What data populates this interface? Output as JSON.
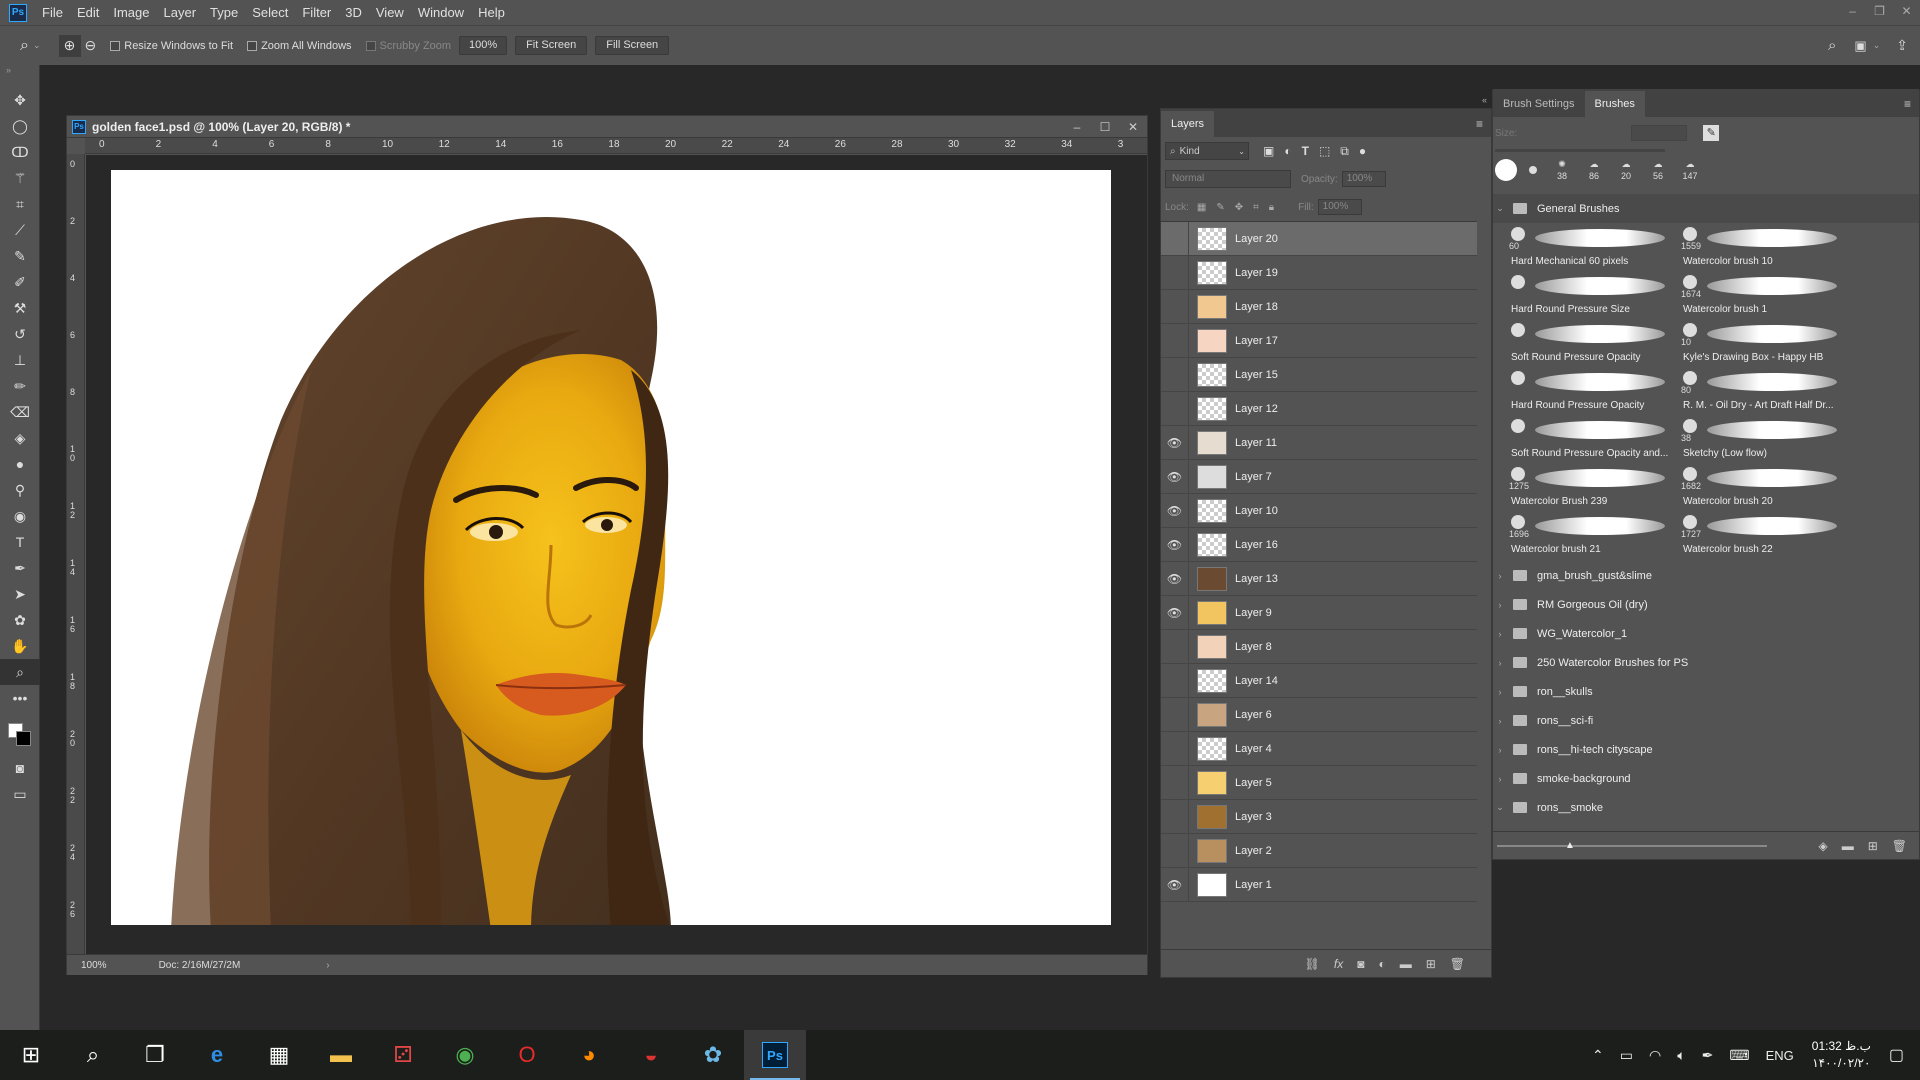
{
  "menu": {
    "logo": "Ps",
    "items": [
      "File",
      "Edit",
      "Image",
      "Layer",
      "Type",
      "Select",
      "Filter",
      "3D",
      "View",
      "Window",
      "Help"
    ]
  },
  "options": {
    "resize_windows": "Resize Windows to Fit",
    "zoom_all": "Zoom All Windows",
    "scrubby": "Scrubby Zoom",
    "zoom_value": "100%",
    "fit_screen": "Fit Screen",
    "fill_screen": "Fill Screen"
  },
  "document": {
    "title": "golden face1.psd @ 100% (Layer 20, RGB/8) *",
    "ruler_top": [
      "0",
      "2",
      "4",
      "6",
      "8",
      "10",
      "12",
      "14",
      "16",
      "18",
      "20",
      "22",
      "24",
      "26",
      "28",
      "30",
      "32",
      "34",
      "3"
    ],
    "ruler_left": [
      "0",
      "2",
      "4",
      "6",
      "8",
      "1 0",
      "1 2",
      "1 4",
      "1 6",
      "1 8",
      "2 0",
      "2 2",
      "2 4",
      "2 6"
    ],
    "zoom": "100%",
    "doc_info": "Doc: 2/16M/27/2M"
  },
  "layers_panel": {
    "tab": "Layers",
    "kind": "Kind",
    "blend": "Normal",
    "opacity_label": "Opacity:",
    "opacity_value": "100%",
    "lock_label": "Lock:",
    "fill_label": "Fill:",
    "fill_value": "100%",
    "layers": [
      {
        "name": "Layer 20",
        "visible": false,
        "selected": true
      },
      {
        "name": "Layer 19",
        "visible": false
      },
      {
        "name": "Layer 18",
        "visible": false
      },
      {
        "name": "Layer 17",
        "visible": false
      },
      {
        "name": "Layer 15",
        "visible": false
      },
      {
        "name": "Layer 12",
        "visible": false
      },
      {
        "name": "Layer 11",
        "visible": true
      },
      {
        "name": "Layer 7",
        "visible": true
      },
      {
        "name": "Layer 10",
        "visible": true
      },
      {
        "name": "Layer 16",
        "visible": true
      },
      {
        "name": "Layer 13",
        "visible": true
      },
      {
        "name": "Layer 9",
        "visible": true
      },
      {
        "name": "Layer 8",
        "visible": false
      },
      {
        "name": "Layer 14",
        "visible": false
      },
      {
        "name": "Layer 6",
        "visible": false
      },
      {
        "name": "Layer 4",
        "visible": false
      },
      {
        "name": "Layer 5",
        "visible": false
      },
      {
        "name": "Layer 3",
        "visible": false
      },
      {
        "name": "Layer 2",
        "visible": false
      },
      {
        "name": "Layer 1",
        "visible": true
      }
    ]
  },
  "brushes_panel": {
    "tab_settings": "Brush Settings",
    "tab_brushes": "Brushes",
    "size_label": "Size:",
    "recent_sizes": [
      "38",
      "86",
      "20",
      "56",
      "147"
    ],
    "general_group": "General Brushes",
    "brushes": [
      {
        "num": "60",
        "name": "Hard Mechanical 60 pixels"
      },
      {
        "num": "1559",
        "name": "Watercolor brush 10"
      },
      {
        "num": "",
        "name": "Hard Round Pressure Size"
      },
      {
        "num": "1674",
        "name": "Watercolor brush 1"
      },
      {
        "num": "",
        "name": "Soft Round Pressure Opacity"
      },
      {
        "num": "10",
        "name": "Kyle's Drawing Box - Happy HB"
      },
      {
        "num": "",
        "name": "Hard Round Pressure Opacity"
      },
      {
        "num": "80",
        "name": "R. M. - Oil Dry - Art Draft Half Dr..."
      },
      {
        "num": "",
        "name": "Soft Round Pressure Opacity and..."
      },
      {
        "num": "38",
        "name": "Sketchy (Low flow)"
      },
      {
        "num": "1275",
        "name": "Watercolor Brush 239"
      },
      {
        "num": "1682",
        "name": "Watercolor brush 20"
      },
      {
        "num": "1696",
        "name": "Watercolor brush 21"
      },
      {
        "num": "1727",
        "name": "Watercolor brush 22"
      }
    ],
    "groups": [
      "gma_brush_gust&slime",
      "RM Gorgeous Oil (dry)",
      "WG_Watercolor_1",
      "250 Watercolor Brushes for PS",
      "ron__skulls",
      "rons__sci-fi",
      "rons__hi-tech cityscape",
      "smoke-background",
      "rons__smoke"
    ]
  },
  "taskbar": {
    "lang": "ENG",
    "time": "01:32 ب.ظ",
    "date": "۱۴۰۰/۰۲/۲۰"
  }
}
